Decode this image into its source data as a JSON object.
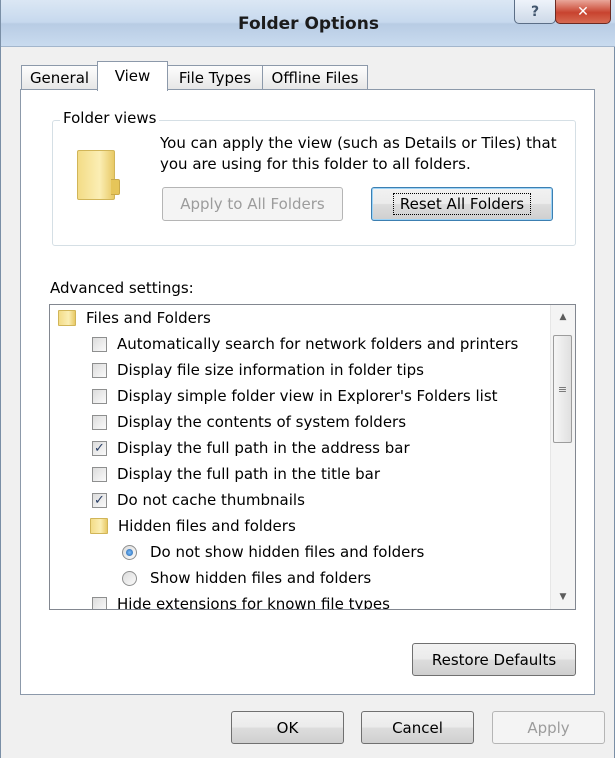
{
  "window": {
    "title": "Folder Options",
    "help_glyph": "?",
    "close_glyph": "✕"
  },
  "tabs": [
    {
      "label": "General"
    },
    {
      "label": "View"
    },
    {
      "label": "File Types"
    },
    {
      "label": "Offline Files"
    }
  ],
  "folder_views": {
    "title": "Folder views",
    "description": "You can apply the view (such as Details or Tiles) that you are using for this folder to all folders.",
    "apply_label": "Apply to All Folders",
    "reset_label": "Reset All Folders"
  },
  "advanced": {
    "label": "Advanced settings:",
    "items": [
      {
        "type": "folder",
        "label": "Files and Folders"
      },
      {
        "type": "checkbox",
        "label": "Automatically search for network folders and printers",
        "checked": false,
        "mark": ""
      },
      {
        "type": "checkbox",
        "label": "Display file size information in folder tips",
        "checked": false,
        "mark": ""
      },
      {
        "type": "checkbox",
        "label": "Display simple folder view in Explorer's Folders list",
        "checked": false,
        "mark": ""
      },
      {
        "type": "checkbox",
        "label": "Display the contents of system folders",
        "checked": false,
        "mark": ""
      },
      {
        "type": "checkbox",
        "label": "Display the full path in the address bar",
        "checked": true,
        "mark": "✓"
      },
      {
        "type": "checkbox",
        "label": "Display the full path in the title bar",
        "checked": false,
        "mark": ""
      },
      {
        "type": "checkbox",
        "label": "Do not cache thumbnails",
        "checked": true,
        "mark": "✓"
      },
      {
        "type": "folder",
        "label": "Hidden files and folders"
      },
      {
        "type": "radio",
        "label": "Do not show hidden files and folders",
        "selected": true
      },
      {
        "type": "radio",
        "label": "Show hidden files and folders",
        "selected": false
      },
      {
        "type": "checkbox",
        "label": "Hide extensions for known file types",
        "checked": false,
        "mark": ""
      }
    ],
    "scroll_up_glyph": "▲",
    "scroll_down_glyph": "▼",
    "scroll_grip_glyph": "≡",
    "restore_label": "Restore Defaults"
  },
  "footer": {
    "ok_label": "OK",
    "cancel_label": "Cancel",
    "apply_label": "Apply"
  }
}
